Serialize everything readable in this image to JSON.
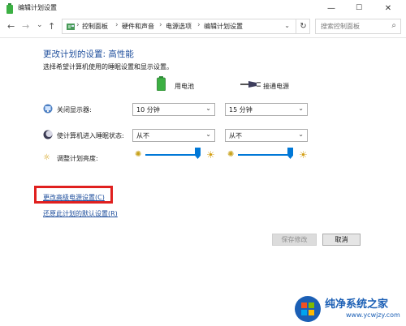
{
  "window": {
    "title": "编辑计划设置",
    "minimize": "—",
    "maximize": "☐",
    "close": "✕"
  },
  "nav": {
    "back": "←",
    "forward": "→",
    "recent": "⌄",
    "up": "↑",
    "breadcrumbs": [
      "控制面板",
      "硬件和声音",
      "电源选项",
      "编辑计划设置"
    ],
    "separator": "›",
    "dropdown": "⌄",
    "refresh": "↻",
    "search_placeholder": "搜索控制面板",
    "search_icon": "⌕"
  },
  "content": {
    "heading": "更改计划的设置: 高性能",
    "subtitle": "选择希望计算机使用的睡眠设置和显示设置。",
    "col_battery": "用电池",
    "col_plugged": "接通电源",
    "rows": [
      {
        "icon": "monitor-icon",
        "label": "关闭显示器:",
        "battery": "10 分钟",
        "plugged": "15 分钟"
      },
      {
        "icon": "moon-icon",
        "label": "使计算机进入睡眠状态:",
        "battery": "从不",
        "plugged": "从不"
      }
    ],
    "brightness": {
      "label": "调整计划亮度:",
      "battery_level": 1.0,
      "plugged_level": 1.0
    },
    "link_advanced": "更改高级电源设置(C)",
    "link_restore": "还原此计划的默认设置(R)",
    "btn_save": "保存修改",
    "btn_cancel": "取消",
    "dropdown_arrow": "⌄"
  },
  "watermark": {
    "text": "纯净系统之家",
    "url": "www.ycwjzy.com"
  },
  "colors": {
    "accent": "#0078d7",
    "link": "#1e4e9c",
    "highlight": "#e0201f",
    "battery_green": "#3cb043"
  }
}
